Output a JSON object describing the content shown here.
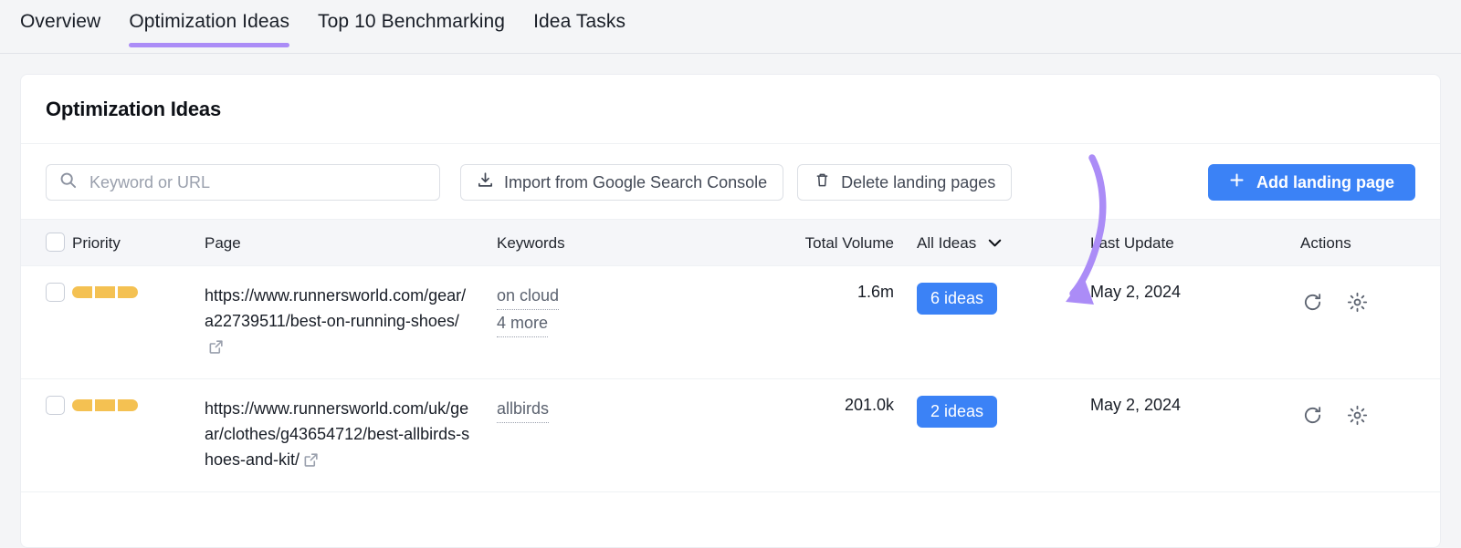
{
  "tabs": [
    {
      "label": "Overview",
      "active": false
    },
    {
      "label": "Optimization Ideas",
      "active": true
    },
    {
      "label": "Top 10 Benchmarking",
      "active": false
    },
    {
      "label": "Idea Tasks",
      "active": false
    }
  ],
  "card": {
    "title": "Optimization Ideas"
  },
  "toolbar": {
    "search_placeholder": "Keyword or URL",
    "search_value": "",
    "search_icon": "search-icon",
    "import_label": "Import from Google Search Console",
    "import_icon": "download-icon",
    "delete_label": "Delete landing pages",
    "delete_icon": "trash-icon",
    "add_label": "Add landing page",
    "add_icon": "plus-icon"
  },
  "table": {
    "headers": {
      "priority": "Priority",
      "page": "Page",
      "keywords": "Keywords",
      "total_volume": "Total Volume",
      "ideas_filter": "All Ideas",
      "ideas_filter_icon": "chevron-down-icon",
      "last_update": "Last Update",
      "actions": "Actions"
    },
    "rows": [
      {
        "priority_filled": 3,
        "priority_total": 3,
        "url": "https://www.runnersworld.com/gear/a22739511/best-on-running-shoes/",
        "external_icon": "external-link-icon",
        "keywords": [
          "on cloud",
          "4 more"
        ],
        "total_volume": "1.6m",
        "ideas_badge": "6 ideas",
        "last_update": "May 2, 2024",
        "action_icons": [
          "refresh-icon",
          "gear-icon"
        ]
      },
      {
        "priority_filled": 3,
        "priority_total": 3,
        "url": "https://www.runnersworld.com/uk/gear/clothes/g43654712/best-allbirds-shoes-and-kit/",
        "external_icon": "external-link-icon",
        "keywords": [
          "allbirds"
        ],
        "total_volume": "201.0k",
        "ideas_badge": "2 ideas",
        "last_update": "May 2, 2024",
        "action_icons": [
          "refresh-icon",
          "gear-icon"
        ]
      }
    ]
  },
  "annotation": {
    "type": "curved-arrow",
    "color": "#ab8cf7",
    "points_to": "6 ideas"
  },
  "colors": {
    "accent_purple": "#ab8cf7",
    "primary_blue": "#3b82f6",
    "priority_amber": "#f4c152",
    "page_bg": "#f4f5f7"
  }
}
